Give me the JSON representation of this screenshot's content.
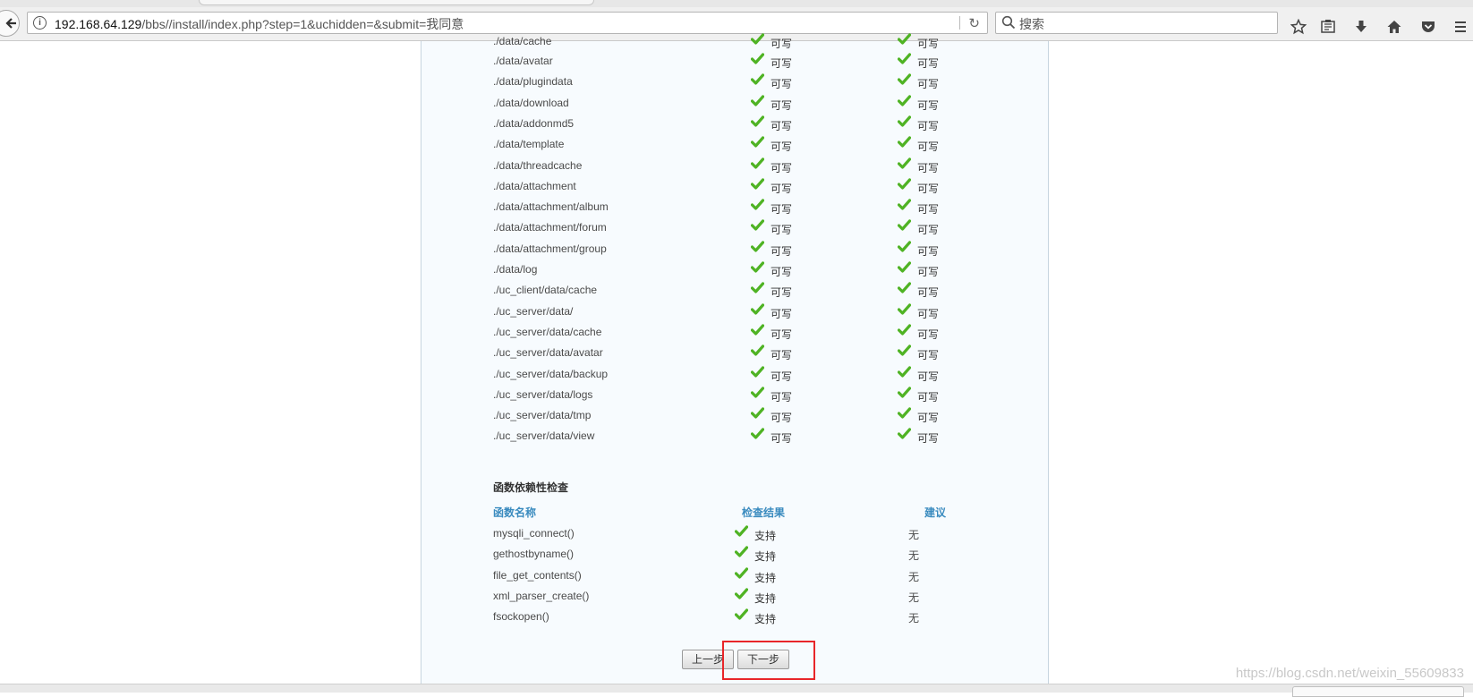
{
  "browser": {
    "url_host": "192.168.64.129",
    "url_path": "/bbs//install/index.php?step=1&uchidden=&submit=我同意",
    "search_placeholder": "搜索"
  },
  "dir_check": {
    "partial_top_row": {
      "name": "./data/cache",
      "current": "可写",
      "required": "可写"
    },
    "rows": [
      {
        "name": "./data/avatar",
        "current": "可写",
        "required": "可写"
      },
      {
        "name": "./data/plugindata",
        "current": "可写",
        "required": "可写"
      },
      {
        "name": "./data/download",
        "current": "可写",
        "required": "可写"
      },
      {
        "name": "./data/addonmd5",
        "current": "可写",
        "required": "可写"
      },
      {
        "name": "./data/template",
        "current": "可写",
        "required": "可写"
      },
      {
        "name": "./data/threadcache",
        "current": "可写",
        "required": "可写"
      },
      {
        "name": "./data/attachment",
        "current": "可写",
        "required": "可写"
      },
      {
        "name": "./data/attachment/album",
        "current": "可写",
        "required": "可写"
      },
      {
        "name": "./data/attachment/forum",
        "current": "可写",
        "required": "可写"
      },
      {
        "name": "./data/attachment/group",
        "current": "可写",
        "required": "可写"
      },
      {
        "name": "./data/log",
        "current": "可写",
        "required": "可写"
      },
      {
        "name": "./uc_client/data/cache",
        "current": "可写",
        "required": "可写"
      },
      {
        "name": "./uc_server/data/",
        "current": "可写",
        "required": "可写"
      },
      {
        "name": "./uc_server/data/cache",
        "current": "可写",
        "required": "可写"
      },
      {
        "name": "./uc_server/data/avatar",
        "current": "可写",
        "required": "可写"
      },
      {
        "name": "./uc_server/data/backup",
        "current": "可写",
        "required": "可写"
      },
      {
        "name": "./uc_server/data/logs",
        "current": "可写",
        "required": "可写"
      },
      {
        "name": "./uc_server/data/tmp",
        "current": "可写",
        "required": "可写"
      },
      {
        "name": "./uc_server/data/view",
        "current": "可写",
        "required": "可写"
      }
    ]
  },
  "func_check": {
    "title": "函数依赖性检查",
    "headers": {
      "name": "函数名称",
      "result": "检查结果",
      "advice": "建议"
    },
    "rows": [
      {
        "name": "mysqli_connect()",
        "result": "支持",
        "advice": "无"
      },
      {
        "name": "gethostbyname()",
        "result": "支持",
        "advice": "无"
      },
      {
        "name": "file_get_contents()",
        "result": "支持",
        "advice": "无"
      },
      {
        "name": "xml_parser_create()",
        "result": "支持",
        "advice": "无"
      },
      {
        "name": "fsockopen()",
        "result": "支持",
        "advice": "无"
      }
    ]
  },
  "buttons": {
    "prev": "上一步",
    "next": "下一步"
  },
  "watermark": "https://blog.csdn.net/weixin_55609833",
  "colors": {
    "check": "#4fb324",
    "header": "#3a8bbf",
    "highlight": "#e8262a"
  }
}
